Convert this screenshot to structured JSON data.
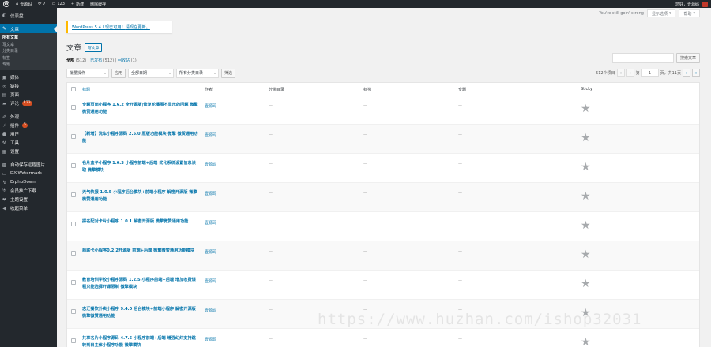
{
  "adminbar": {
    "site_name": "壹源码",
    "updates_count": "7",
    "comments_count": "123",
    "new_label": "新建",
    "clear_cache": "删除缓存",
    "greeting": "您好，壹源码"
  },
  "sidebar": {
    "dashboard": "仪表盘",
    "posts": "文章",
    "posts_sub": [
      "所有文章",
      "写文章",
      "分类目录",
      "标签",
      "专题"
    ],
    "media": "媒体",
    "links": "链接",
    "pages": "页面",
    "comments": "评论",
    "comments_badge": "123",
    "appearance": "外观",
    "plugins": "插件",
    "plugins_badge": "5",
    "users": "用户",
    "tools": "工具",
    "settings": "设置",
    "auto_save_images": "自动保存远程图片",
    "dx_watermark": "DX-Watermark",
    "erphpdown": "ErphpDown",
    "member_promo": "会员推广下载",
    "theme_settings": "主题设置",
    "collapse": "收起菜单"
  },
  "screen_meta": {
    "quote": "You're still goin' strong",
    "screen_options": "显示选项",
    "help": "帮助"
  },
  "notice": {
    "update_available": "WordPress 5.4.1现已可用！",
    "update_link": "请现在更新。"
  },
  "page": {
    "title": "文章",
    "add_new": "写文章"
  },
  "filters": {
    "all_label": "全部",
    "all_count": "(512)",
    "published_label": "已发布",
    "published_count": "(512)",
    "trash_label": "回收站",
    "trash_count": "(1)"
  },
  "search": {
    "button": "搜索文章"
  },
  "tablenav": {
    "bulk_action": "批量操作",
    "apply": "应用",
    "all_dates": "全部日期",
    "all_categories": "所有分类目录",
    "filter": "筛选",
    "items_count": "512个项目",
    "first": "«",
    "prev": "‹",
    "page_prefix": "第",
    "current_page": "1",
    "page_suffix": "页，共11页",
    "next": "›",
    "last": "»"
  },
  "table": {
    "columns": {
      "title": "标题",
      "author": "作者",
      "categories": "分类目录",
      "tags": "标签",
      "topics": "专题",
      "sticky": "Sticky"
    },
    "rows": [
      {
        "title": "专题页面小程序 1.6.2 全开源版|修复轮播图不显示的问题 微擎微赞通用功能",
        "author": "壹源码",
        "dash": "—"
      },
      {
        "title": "【新增】洗车小程序源码 2.5.0 原版功能模块 微擎 微赞通用功能",
        "author": "壹源码",
        "dash": "—"
      },
      {
        "title": "名片盒子小程序 1.0.3 小程序前端+后端 优化系统设置信息读取 微擎模块",
        "author": "壹源码",
        "dash": "—"
      },
      {
        "title": "天气快报 1.0.5 小程序后台模块+前端小程序 解密开源版 微擎微赞通用功能",
        "author": "壹源码",
        "dash": "—"
      },
      {
        "title": "拼名配对卡片小程序 1.0.1 解密开源版 微擎微赞通用功能",
        "author": "壹源码",
        "dash": "—"
      },
      {
        "title": "商联卡小程序0.2.2开源版 前端+后端 微擎微赞通用功能模块",
        "author": "壹源码",
        "dash": "—"
      },
      {
        "title": "教育培训学校小程序源码 1.2.5 小程序前端+后端 增加收费课程只能选择开课限制 微擎模块",
        "author": "壹源码",
        "dash": "—"
      },
      {
        "title": "志汇餐饮外卖小程序 9.4.0 后台模块+前端小程序 解密开源版 微擎微赞通用功能",
        "author": "壹源码",
        "dash": "—"
      },
      {
        "title": "共享名片小程序源码 4.7.5 小程序前端+后端 增强幻灯支持跳转到目主体小程序功能 微擎模块",
        "author": "壹源码",
        "dash": "—"
      }
    ]
  },
  "watermark": "https://www.huzhan.com/ishop32031"
}
